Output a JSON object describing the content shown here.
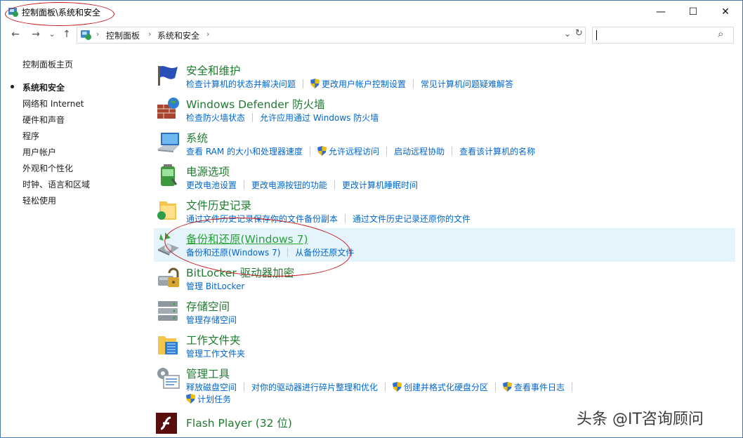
{
  "window": {
    "title": "控制面板\\系统和安全",
    "minimize": "—",
    "maximize": "☐",
    "close": "✕"
  },
  "nav": {
    "back": "←",
    "forward": "→",
    "recent": "⌄",
    "up": "↑",
    "dropdown": "⌄",
    "refresh": "↻",
    "search_icon": "⌕"
  },
  "breadcrumb": [
    "控制面板",
    "系统和安全"
  ],
  "breadcrumb_sep": "›",
  "search": {
    "value": "",
    "placeholder": ""
  },
  "sidebar": {
    "items": [
      {
        "label": "控制面板主页"
      },
      {
        "label": "系统和安全",
        "active": true
      },
      {
        "label": "网络和 Internet"
      },
      {
        "label": "硬件和声音"
      },
      {
        "label": "程序"
      },
      {
        "label": "用户帐户"
      },
      {
        "label": "外观和个性化"
      },
      {
        "label": "时钟、语言和区域"
      },
      {
        "label": "轻松使用"
      }
    ]
  },
  "categories": [
    {
      "title": "安全和维护",
      "icon": "flag-icon",
      "links": [
        "检查计算机的状态并解决问题",
        "更改用户帐户控制设置",
        "常见计算机问题疑难解答"
      ]
    },
    {
      "title": "Windows Defender 防火墙",
      "icon": "firewall-icon",
      "links": [
        "检查防火墙状态",
        "允许应用通过 Windows 防火墙"
      ]
    },
    {
      "title": "系统",
      "icon": "computer-icon",
      "links": [
        "查看 RAM 的大小和处理器速度",
        "允许远程访问",
        "启动远程协助",
        "查看该计算机的名称"
      ]
    },
    {
      "title": "电源选项",
      "icon": "battery-icon",
      "links": [
        "更改电池设置",
        "更改电源按钮的功能",
        "更改计算机睡眠时间"
      ]
    },
    {
      "title": "文件历史记录",
      "icon": "folder-history-icon",
      "links": [
        "通过文件历史记录保存你的文件备份副本",
        "通过文件历史记录还原你的文件"
      ]
    },
    {
      "title": "备份和还原(Windows 7)",
      "icon": "backup-icon",
      "links": [
        "备份和还原(Windows 7)",
        "从备份还原文件"
      ]
    },
    {
      "title": "BitLocker 驱动器加密",
      "icon": "bitlocker-icon",
      "links": [
        "管理 BitLocker"
      ]
    },
    {
      "title": "存储空间",
      "icon": "storage-icon",
      "links": [
        "管理存储空间"
      ]
    },
    {
      "title": "工作文件夹",
      "icon": "work-folder-icon",
      "links": [
        "管理工作文件夹"
      ]
    },
    {
      "title": "管理工具",
      "icon": "admin-tools-icon",
      "links": [
        "释放磁盘空间",
        "对你的驱动器进行碎片整理和优化",
        "创建并格式化硬盘分区",
        "查看事件日志",
        "计划任务"
      ]
    },
    {
      "title": "Flash Player (32 位)",
      "icon": "flash-icon",
      "links": []
    }
  ],
  "watermark": "头条 @IT咨询顾问",
  "colors": {
    "category_title": "#1e7b2f",
    "link": "#0066cc",
    "highlight": "#e5f3fb",
    "annotation": "#c4161c"
  }
}
